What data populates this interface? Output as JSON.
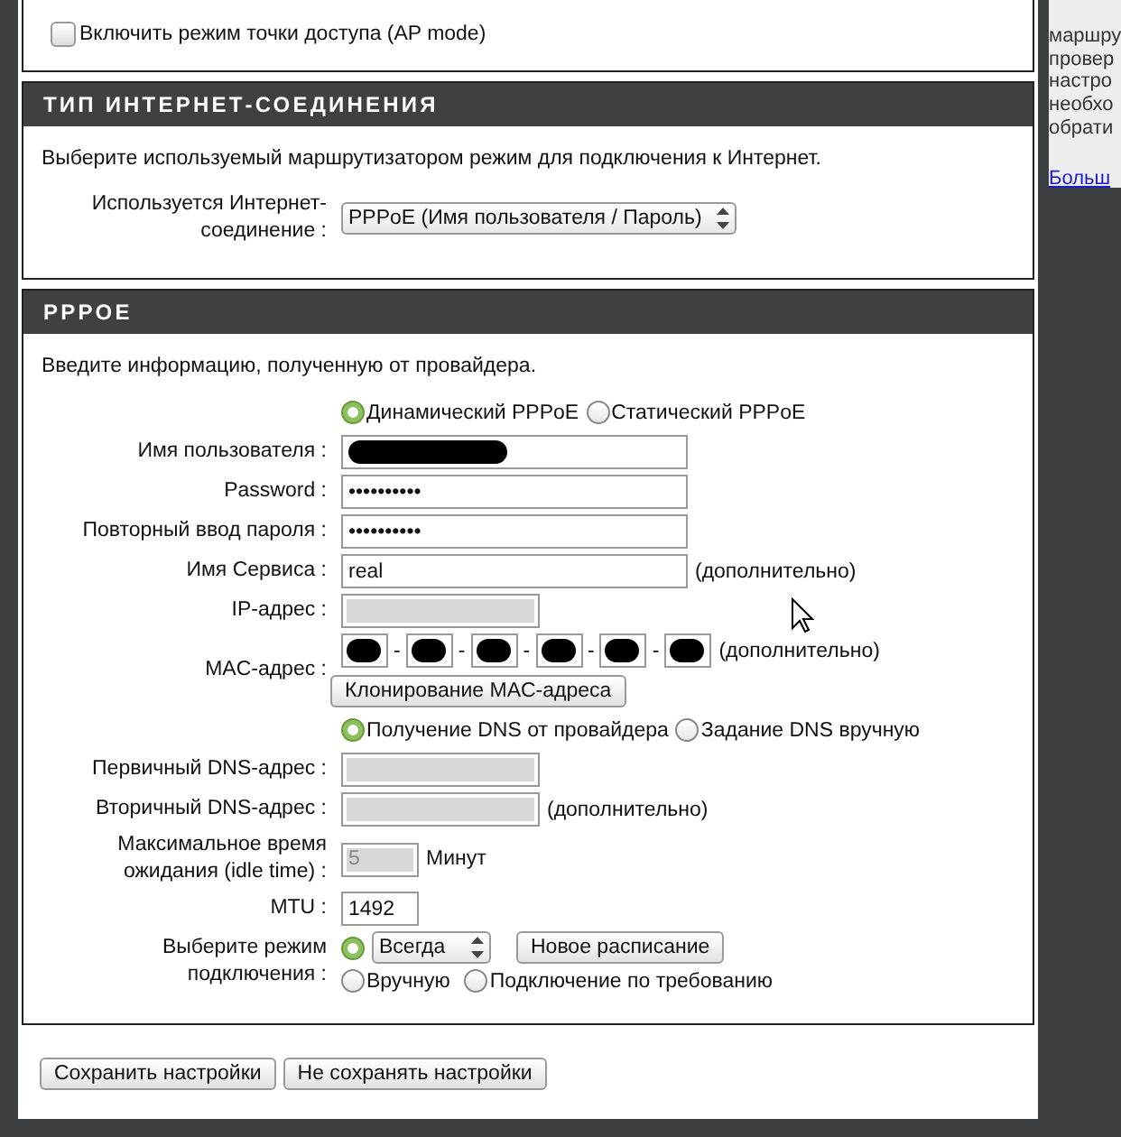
{
  "ap_mode": {
    "label": "Включить режим точки доступа (AP mode)",
    "checked": false
  },
  "internet_type": {
    "title": "ТИП ИНТЕРНЕТ-СОЕДИНЕНИЯ",
    "description": "Выберите используемый маршрутизатором режим для подключения к Интернет.",
    "label": "Используется Интернет-соединение :",
    "select_value": "PPPoE (Имя пользователя / Пароль)"
  },
  "pppoe": {
    "title": "PPPOE",
    "description": "Введите информацию, полученную от провайдера.",
    "rows": [
      {
        "kind": "radios",
        "options": [
          {
            "label": "Динамический PPPoE",
            "selected": true
          },
          {
            "label": "Статический PPPoE",
            "selected": false
          }
        ]
      },
      {
        "kind": "redacted",
        "label": "Имя пользователя :"
      },
      {
        "kind": "password",
        "label": "Password :",
        "value": "••••••••••"
      },
      {
        "kind": "password",
        "label": "Повторный ввод пароля :",
        "value": "••••••••••"
      },
      {
        "kind": "text",
        "label": "Имя Сервиса :",
        "value": "real",
        "note": "(дополнительно)"
      },
      {
        "kind": "address",
        "label": "IP-адрес :",
        "disabled": true
      },
      {
        "kind": "mac",
        "label": "MAC-адрес :",
        "separators": [
          "-",
          "-",
          "-",
          "-",
          "-"
        ],
        "note": "(дополнительно)",
        "button": "Клонирование MAC-адреса"
      },
      {
        "kind": "radios",
        "options": [
          {
            "label": "Получение DNS от провайдера",
            "selected": true
          },
          {
            "label": "Задание DNS вручную",
            "selected": false
          }
        ]
      },
      {
        "kind": "address",
        "label": "Первичный DNS-адрес :",
        "disabled": true
      },
      {
        "kind": "address",
        "label": "Вторичный DNS-адрес :",
        "disabled": true,
        "note": "(дополнительно)"
      },
      {
        "kind": "number",
        "label": "Максимальное время ожидания (idle time) :",
        "value": "5",
        "disabled": true,
        "note": "Минут"
      },
      {
        "kind": "number",
        "label": "MTU :",
        "value": "1492",
        "disabled": false
      },
      {
        "kind": "connect",
        "label": "Выберите режим подключения :",
        "select_value": "Всегда",
        "schedule_button": "Новое расписание",
        "options": [
          {
            "selected": true
          },
          {
            "label": "Вручную",
            "selected": false
          },
          {
            "label": "Подключение по требованию",
            "selected": false
          }
        ]
      }
    ]
  },
  "buttons": [
    "Сохранить настройки",
    "Не сохранять настройки"
  ],
  "sidebar": {
    "lines": [
      "маршру",
      "провер",
      "настро",
      "необхо",
      "обрати"
    ],
    "link": "Больш"
  }
}
